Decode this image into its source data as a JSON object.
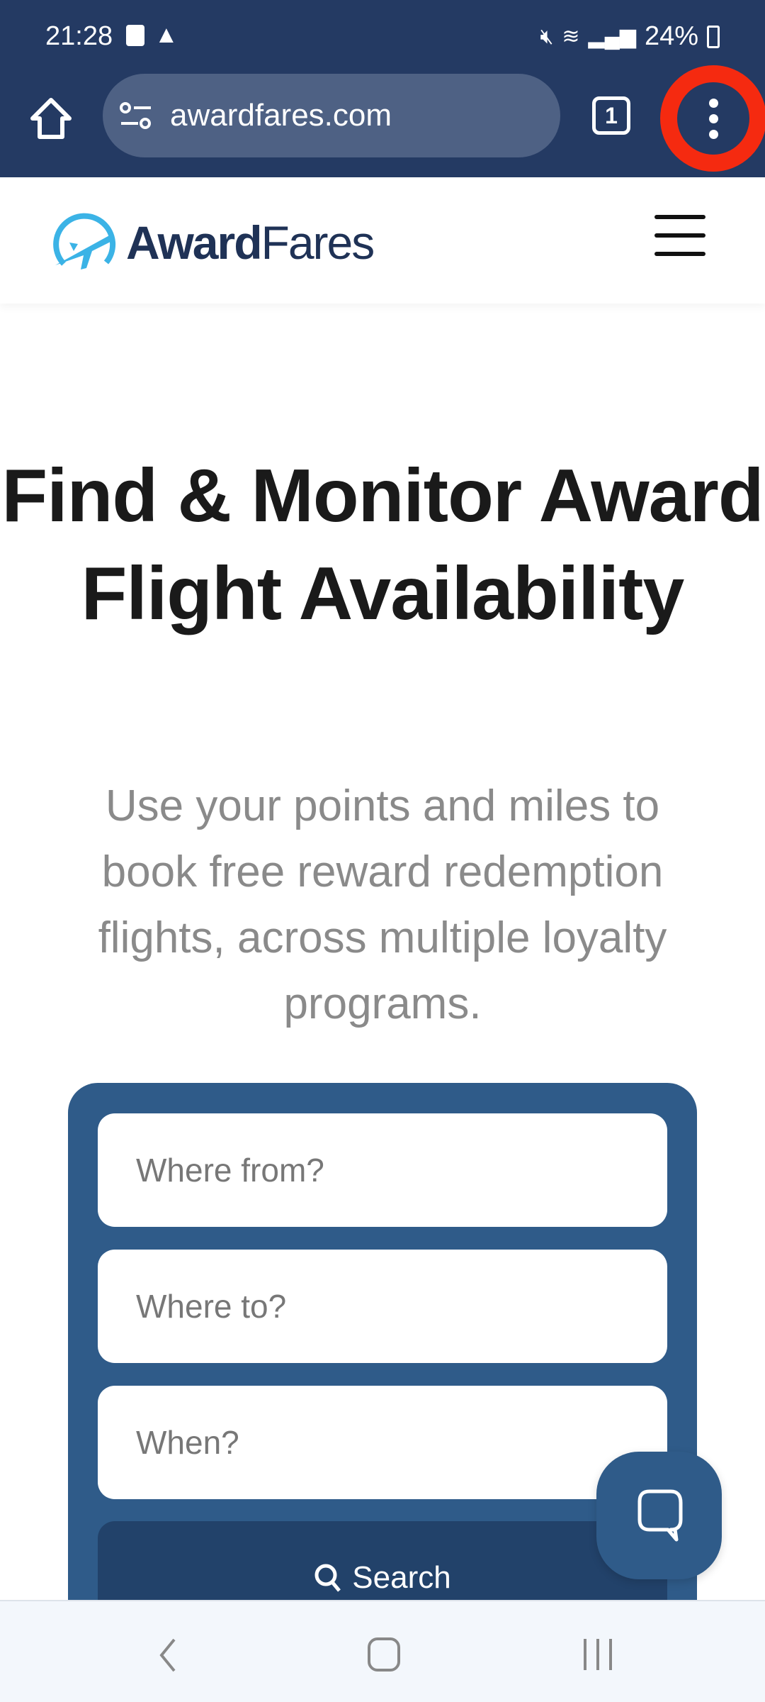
{
  "status_bar": {
    "time": "21:28",
    "battery": "24%"
  },
  "browser": {
    "url": "awardfares.com",
    "tab_count": "1",
    "highlight_color": "#f52a10"
  },
  "site": {
    "logo_bold": "Award",
    "logo_light": "Fares",
    "hero": {
      "title": "Find & Monitor Award Flight Availability",
      "subtitle": "Use your points and miles to book free reward redemption flights, across multiple loyalty programs."
    },
    "search": {
      "from_placeholder": "Where from?",
      "to_placeholder": "Where to?",
      "when_placeholder": "When?",
      "button": "Search"
    },
    "colors": {
      "brand": "#2f5b89",
      "button": "#22426a",
      "logo_accent": "#3bb3e6"
    }
  }
}
